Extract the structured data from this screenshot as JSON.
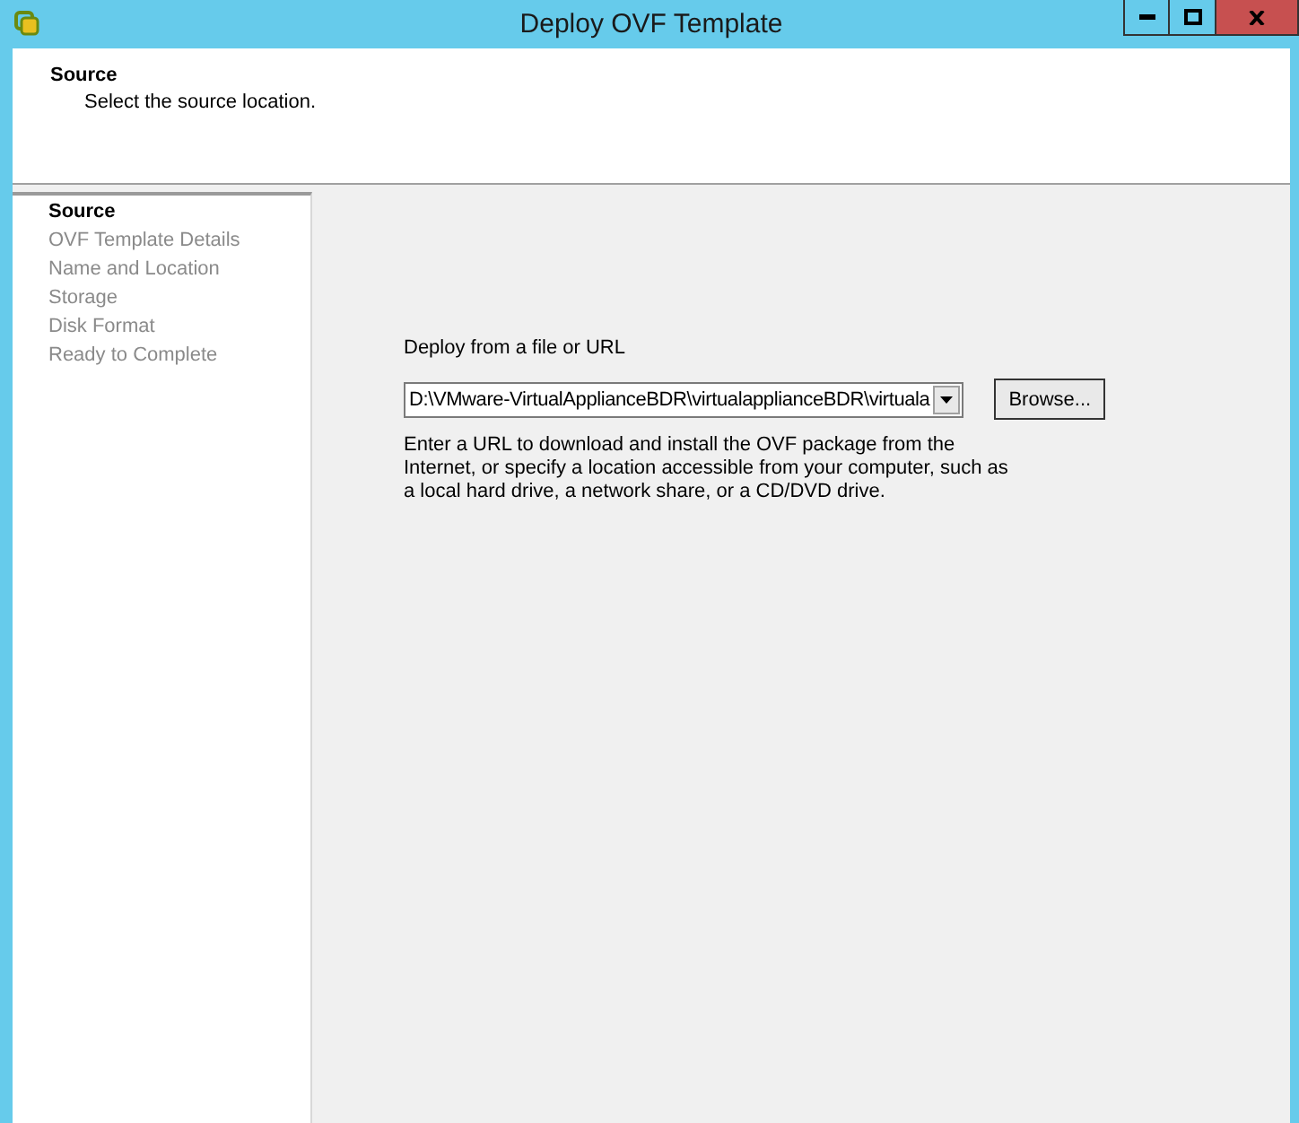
{
  "window": {
    "title": "Deploy OVF Template"
  },
  "header": {
    "title": "Source",
    "subtitle": "Select the source location."
  },
  "steps": [
    {
      "label": "Source",
      "selected": true
    },
    {
      "label": "OVF Template Details",
      "selected": false
    },
    {
      "label": "Name and Location",
      "selected": false
    },
    {
      "label": "Storage",
      "selected": false
    },
    {
      "label": "Disk Format",
      "selected": false
    },
    {
      "label": "Ready to Complete",
      "selected": false
    }
  ],
  "source": {
    "label": "Deploy from a file or URL",
    "value": "D:\\VMware-VirtualApplianceBDR\\virtualapplianceBDR\\virtuala",
    "browse_button": "Browse...",
    "help": "Enter a URL to download and install the OVF package from the Internet, or specify a location accessible from your computer, such as a local hard drive, a network share, or a CD/DVD drive."
  }
}
